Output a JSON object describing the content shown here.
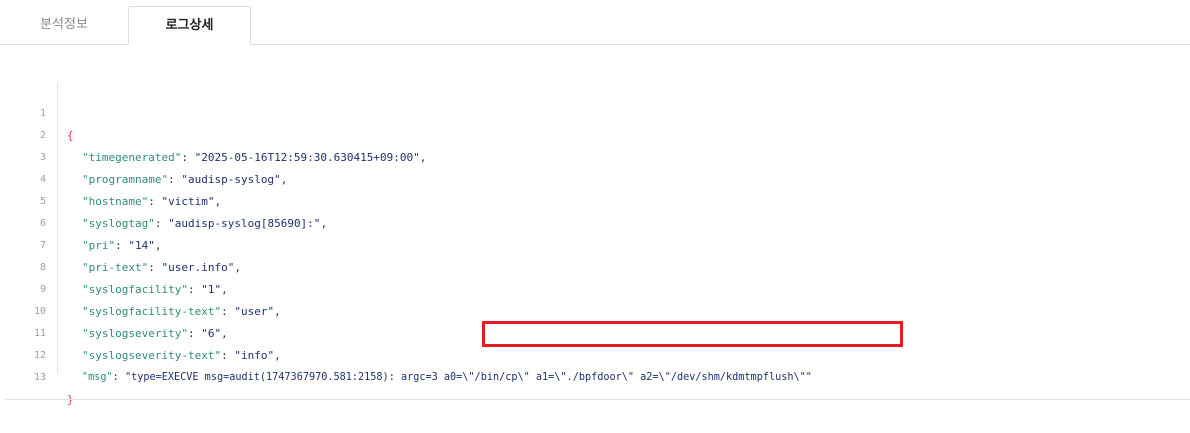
{
  "tabs": [
    {
      "label": "분석정보",
      "active": false
    },
    {
      "label": "로그상세",
      "active": true
    }
  ],
  "editor": {
    "open_brace": "{",
    "close_brace": "}",
    "lines": [
      {
        "num": "1"
      },
      {
        "num": "2",
        "key": "\"timegenerated\"",
        "value": "\"2025-05-16T12:59:30.630415+09:00\""
      },
      {
        "num": "3",
        "key": "\"programname\"",
        "value": "\"audisp-syslog\""
      },
      {
        "num": "4",
        "key": "\"hostname\"",
        "value": "\"victim\""
      },
      {
        "num": "5",
        "key": "\"syslogtag\"",
        "value": "\"audisp-syslog[85690]:\""
      },
      {
        "num": "6",
        "key": "\"pri\"",
        "value": "\"14\""
      },
      {
        "num": "7",
        "key": "\"pri-text\"",
        "value": "\"user.info\""
      },
      {
        "num": "8",
        "key": "\"syslogfacility\"",
        "value": "\"1\""
      },
      {
        "num": "9",
        "key": "\"syslogfacility-text\"",
        "value": "\"user\""
      },
      {
        "num": "10",
        "key": "\"syslogseverity\"",
        "value": "\"6\""
      },
      {
        "num": "11",
        "key": "\"syslogseverity-text\"",
        "value": "\"info\""
      },
      {
        "num": "12",
        "key": "\"msg\"",
        "value": "\"type=EXECVE msg=audit(1747367970.581:2158): argc=3 a0=\\\"/bin/cp\\\" a1=\\\"./bpfdoor\\\" a2=\\\"/dev/shm/kdmtmpflush\\\"\""
      },
      {
        "num": "13"
      }
    ]
  },
  "colors": {
    "key": "#2e8b7a",
    "string": "#1f2f6e",
    "brace": "#d04040",
    "highlight_border": "#e31d24"
  }
}
